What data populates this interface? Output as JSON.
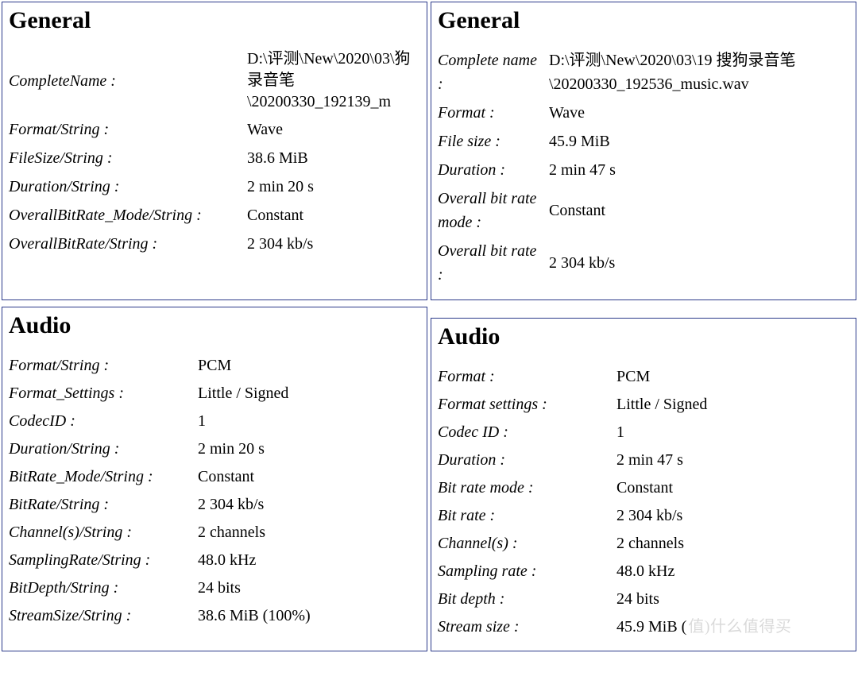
{
  "panels": {
    "generalLeft": {
      "title": "General",
      "rows": [
        {
          "label": "CompleteName :",
          "value": "D:\\评测\\New\\2020\\03\\狗录音笔\\20200330_192139_m"
        },
        {
          "label": "Format/String :",
          "value": "Wave"
        },
        {
          "label": "FileSize/String :",
          "value": "38.6 MiB"
        },
        {
          "label": "Duration/String :",
          "value": "2 min 20 s"
        },
        {
          "label": "OverallBitRate_Mode/String :",
          "value": "Constant"
        },
        {
          "label": "OverallBitRate/String :",
          "value": "2 304 kb/s"
        }
      ]
    },
    "generalRight": {
      "title": "General",
      "rows": [
        {
          "label": "Complete name :",
          "value": "D:\\评测\\New\\2020\\03\\19 搜狗录音笔\\20200330_192536_music.wav"
        },
        {
          "label": "Format :",
          "value": "Wave"
        },
        {
          "label": "File size :",
          "value": "45.9 MiB"
        },
        {
          "label": "Duration :",
          "value": "2 min 47 s"
        },
        {
          "label": "Overall bit rate mode :",
          "value": "Constant"
        },
        {
          "label": "Overall bit rate :",
          "value": "2 304 kb/s"
        }
      ]
    },
    "audioLeft": {
      "title": "Audio",
      "rows": [
        {
          "label": "Format/String :",
          "value": "PCM"
        },
        {
          "label": "Format_Settings :",
          "value": "Little / Signed"
        },
        {
          "label": "CodecID :",
          "value": "1"
        },
        {
          "label": "Duration/String :",
          "value": "2 min 20 s"
        },
        {
          "label": "BitRate_Mode/String :",
          "value": "Constant"
        },
        {
          "label": "BitRate/String :",
          "value": "2 304 kb/s"
        },
        {
          "label": "Channel(s)/String :",
          "value": "2 channels"
        },
        {
          "label": "SamplingRate/String :",
          "value": "48.0 kHz"
        },
        {
          "label": "BitDepth/String :",
          "value": "24 bits"
        },
        {
          "label": "StreamSize/String :",
          "value": "38.6 MiB (100%)"
        }
      ]
    },
    "audioRight": {
      "title": "Audio",
      "rows": [
        {
          "label": "Format :",
          "value": "PCM"
        },
        {
          "label": "Format settings :",
          "value": "Little / Signed"
        },
        {
          "label": "Codec ID :",
          "value": "1"
        },
        {
          "label": "Duration :",
          "value": "2 min 47 s"
        },
        {
          "label": "Bit rate mode :",
          "value": "Constant"
        },
        {
          "label": "Bit rate :",
          "value": "2 304 kb/s"
        },
        {
          "label": "Channel(s) :",
          "value": "2 channels"
        },
        {
          "label": "Sampling rate :",
          "value": "48.0 kHz"
        },
        {
          "label": "Bit depth :",
          "value": "24 bits"
        },
        {
          "label": "Stream size :",
          "value": "45.9 MiB ("
        }
      ],
      "watermark": "值)什么值得买"
    }
  }
}
